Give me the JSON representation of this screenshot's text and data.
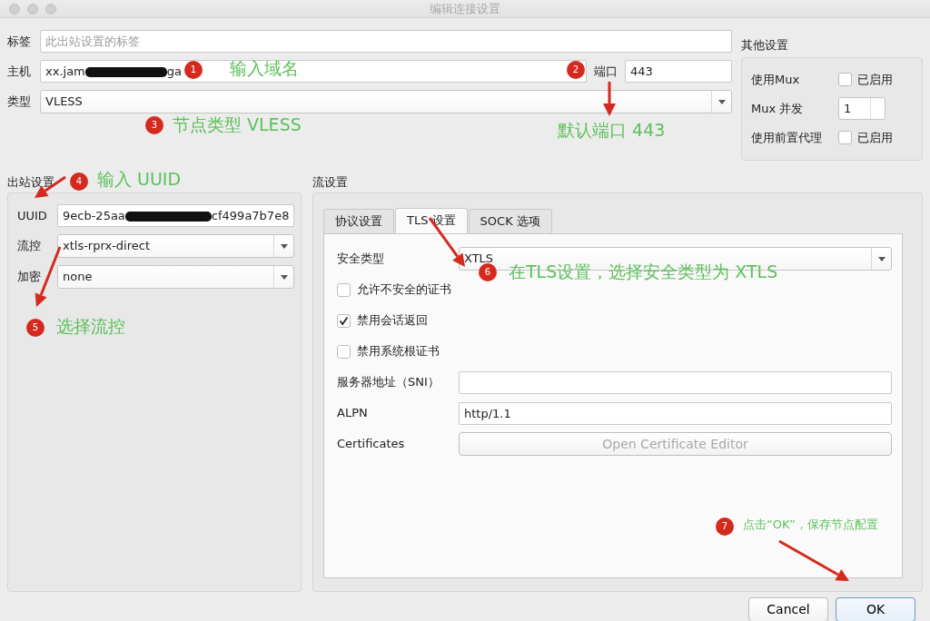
{
  "window": {
    "title": "编辑连接设置"
  },
  "general": {
    "tag": {
      "label": "标签",
      "placeholder": "此出站设置的标签"
    },
    "host": {
      "label": "主机",
      "value_parts": [
        "xx.jam",
        "ga"
      ]
    },
    "port": {
      "label": "端口",
      "value": "443"
    },
    "type": {
      "label": "类型",
      "value": "VLESS"
    }
  },
  "other_settings": {
    "title": "其他设置",
    "rows": [
      {
        "kind": "checkbox",
        "label": "使用Mux",
        "text": "已启用",
        "checked": false
      },
      {
        "kind": "spin",
        "label": "Mux 并发",
        "value": "1"
      },
      {
        "kind": "checkbox",
        "label": "使用前置代理",
        "text": "已启用",
        "checked": false
      }
    ]
  },
  "outbound": {
    "title": "出站设置",
    "rows": [
      {
        "kind": "redacted",
        "label": "UUID",
        "value_parts": [
          "9ecb-25aa",
          "cf499a7b7e8"
        ]
      },
      {
        "kind": "select",
        "label": "流控",
        "value": "xtls-rprx-direct"
      },
      {
        "kind": "select",
        "label": "加密",
        "value": "none"
      }
    ]
  },
  "stream": {
    "title": "流设置",
    "tabs": [
      {
        "label": "协议设置",
        "selected": false
      },
      {
        "label": "TLS 设置",
        "selected": true
      },
      {
        "label": "SOCK 选项",
        "selected": false
      }
    ],
    "rows": [
      {
        "kind": "select",
        "label": "安全类型",
        "value": "XTLS"
      },
      {
        "kind": "checkbox",
        "text": "允许不安全的证书",
        "checked": false
      },
      {
        "kind": "checkbox",
        "text": "禁用会话返回",
        "checked": true
      },
      {
        "kind": "checkbox",
        "text": "禁用系统根证书",
        "checked": false
      },
      {
        "kind": "text",
        "label": "服务器地址（SNI）"
      },
      {
        "kind": "text",
        "label": "ALPN",
        "value": "http/1.1"
      },
      {
        "kind": "button",
        "label": "Certificates",
        "text": "Open Certificate Editor",
        "disabled": true
      }
    ]
  },
  "buttons": [
    {
      "label": "Cancel",
      "default": false
    },
    {
      "label": "OK",
      "default": true
    }
  ],
  "annotations": [
    {
      "number": "1",
      "text": "输入域名"
    },
    {
      "number": "3",
      "text": "节点类型 VLESS"
    },
    {
      "number": "2",
      "text": "默认端口 443"
    },
    {
      "number": "4",
      "text": "输入 UUID"
    },
    {
      "number": "5",
      "text": "选择流控"
    },
    {
      "number": "6",
      "text": "在TLS设置，选择安全类型为 XTLS"
    },
    {
      "number": "7",
      "text": "点击“OK”，保存节点配置"
    }
  ]
}
